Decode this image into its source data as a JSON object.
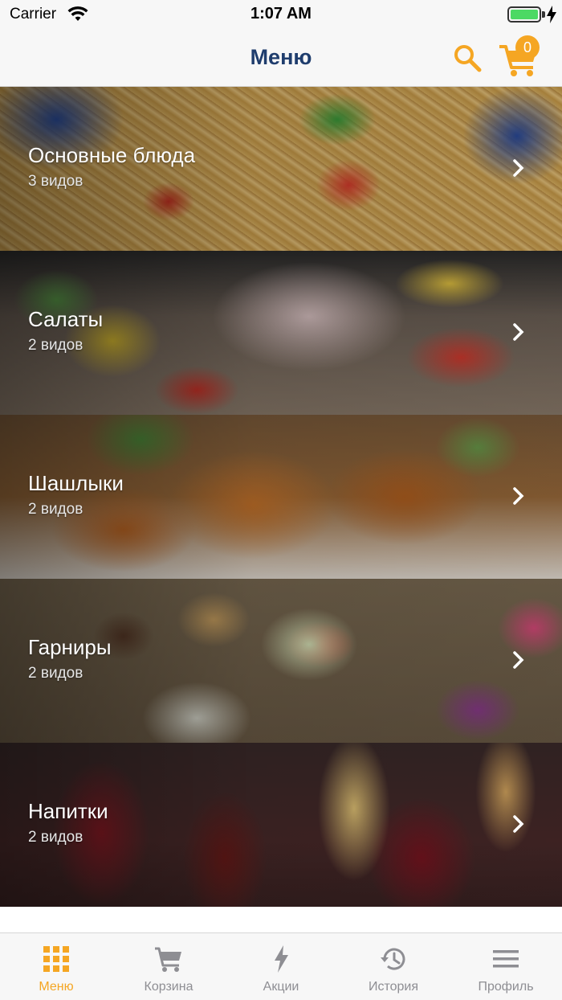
{
  "status_bar": {
    "carrier": "Carrier",
    "time": "1:07 AM",
    "battery_level": 1.0,
    "wifi_icon": "wifi-icon",
    "battery_icon": "battery-icon",
    "charging_icon": "charging-bolt-icon"
  },
  "nav": {
    "title": "Меню",
    "search_icon": "search-icon",
    "cart_icon": "cart-icon",
    "cart_count": "0",
    "accent_color": "#f5a623",
    "title_color": "#1f3d6d"
  },
  "categories": [
    {
      "name": "Основные блюда",
      "count": "3 видов"
    },
    {
      "name": "Салаты",
      "count": "2 видов"
    },
    {
      "name": "Шашлыки",
      "count": "2 видов"
    },
    {
      "name": "Гарниры",
      "count": "2 видов"
    },
    {
      "name": "Напитки",
      "count": "2 видов"
    }
  ],
  "tab_bar": {
    "active_color": "#f5a623",
    "inactive_color": "#8e8e93",
    "tabs": [
      {
        "label": "Меню",
        "icon": "grid-icon",
        "active": true
      },
      {
        "label": "Корзина",
        "icon": "cart-icon",
        "active": false
      },
      {
        "label": "Акции",
        "icon": "lightning-icon",
        "active": false
      },
      {
        "label": "История",
        "icon": "history-icon",
        "active": false
      },
      {
        "label": "Профиль",
        "icon": "hamburger-menu-icon",
        "active": false
      }
    ]
  }
}
